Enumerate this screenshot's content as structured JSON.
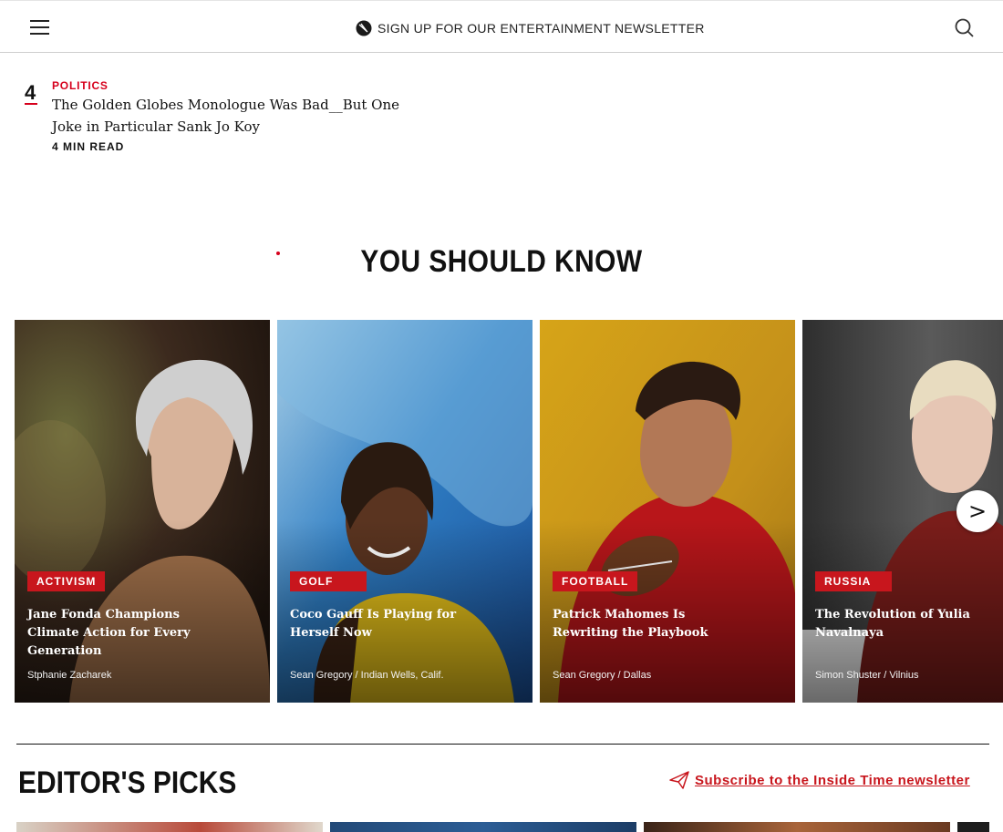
{
  "header": {
    "menu_icon": "hamburger-menu-icon",
    "newsletter_icon": "time-logo-icon",
    "newsletter_label": "SIGN UP FOR OUR ENTERTAINMENT NEWSLETTER",
    "search_icon": "search-icon"
  },
  "ranked_story": {
    "rank": "4",
    "category": "POLITICS",
    "title": "The Golden Globes Monologue Was Bad__But One Joke in Particular Sank Jo Koy",
    "read_time": "4 MIN READ"
  },
  "you_should_know": {
    "title": "YOU SHOULD KNOW",
    "next_label": ">",
    "cards": [
      {
        "tag": "ACTIVISM",
        "headline": "Jane Fonda Champions Climate Action for Every Generation",
        "byline": "Stphanie Zacharek"
      },
      {
        "tag": "GOLF",
        "headline": "Coco Gauff Is Playing for Herself Now",
        "byline": "Sean Gregory / Indian Wells, Calif."
      },
      {
        "tag": "FOOTBALL",
        "headline": "Patrick Mahomes Is Rewriting the Playbook",
        "byline": "Sean Gregory / Dallas"
      },
      {
        "tag": "RUSSIA",
        "headline": "The Revolution of Yulia Navalnaya",
        "byline": "Simon Shuster / Vilnius"
      }
    ]
  },
  "editors_picks": {
    "title": "EDITOR'S PICKS",
    "subscribe_icon": "paper-plane-icon",
    "subscribe_label": "Subscribe to the Inside Time newsletter"
  },
  "colors": {
    "accent_red": "#c8161d",
    "rank_red": "#d6001c"
  }
}
